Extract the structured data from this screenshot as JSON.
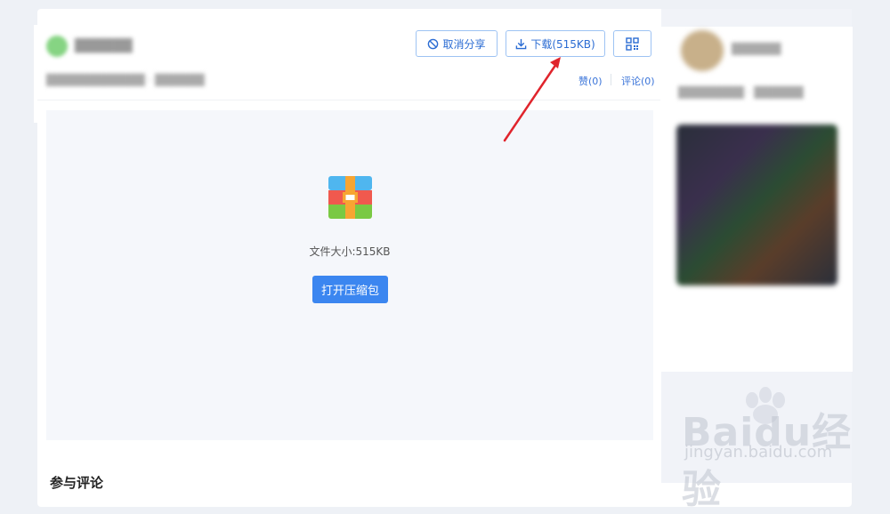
{
  "toolbar": {
    "cancel_share_label": "取消分享",
    "download_label": "下载(515KB)"
  },
  "stats": {
    "like_label": "赞(0)",
    "comment_label": "评论(0)"
  },
  "preview": {
    "file_size_text": "文件大小:515KB",
    "open_button_label": "打开压缩包"
  },
  "comments": {
    "section_title": "参与评论"
  },
  "watermark": {
    "brand": "Baidu经验",
    "url": "jingyan.baidu.com"
  },
  "icons": {
    "cancel": "ban-icon",
    "download": "download-icon",
    "qrcode": "qrcode-icon",
    "file": "zip-archive-icon"
  },
  "colors": {
    "accent": "#3b86f0",
    "link": "#3a74d9",
    "arrow": "#e0242c"
  }
}
